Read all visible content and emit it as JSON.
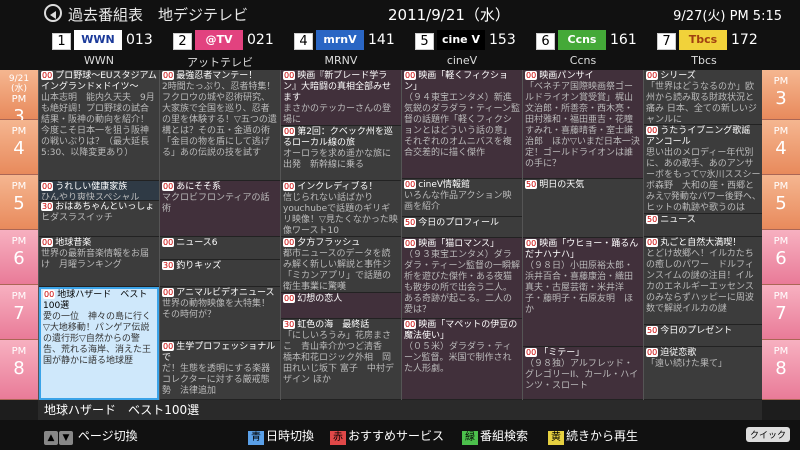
{
  "header": {
    "title": "過去番組表　地デジテレビ",
    "date": "2011/9/21（水）",
    "now": "9/27(火) PM 5:15"
  },
  "channels": [
    {
      "num": "1",
      "logo": "WWN",
      "logo_bg": "#ffffff",
      "logo_fg": "#1b3a9a",
      "cnum": "013",
      "name": "WWN"
    },
    {
      "num": "2",
      "logo": "@TV",
      "logo_bg": "#e2427f",
      "logo_fg": "#ffffff",
      "cnum": "021",
      "name": "アットテレビ"
    },
    {
      "num": "4",
      "logo": "mrnV",
      "logo_bg": "#2a66c4",
      "logo_fg": "#ffffff",
      "cnum": "141",
      "name": "MRNV"
    },
    {
      "num": "5",
      "logo": "cine V",
      "logo_bg": "#000000",
      "logo_fg": "#ffffff",
      "cnum": "153",
      "name": "cineV"
    },
    {
      "num": "6",
      "logo": "Ccns",
      "logo_bg": "#44a938",
      "logo_fg": "#ffffff",
      "cnum": "161",
      "name": "Ccns"
    },
    {
      "num": "7",
      "logo": "Tbcs",
      "logo_bg": "#f1d23a",
      "logo_fg": "#a04010",
      "cnum": "172",
      "name": "Tbcs"
    }
  ],
  "hours": [
    {
      "date": "9/21\n(水)",
      "pm": "PM",
      "h": "3"
    },
    {
      "pm": "PM",
      "h": "4"
    },
    {
      "pm": "PM",
      "h": "5"
    },
    {
      "pm": "PM",
      "h": "6"
    },
    {
      "pm": "PM",
      "h": "7"
    },
    {
      "pm": "PM",
      "h": "8"
    }
  ],
  "columns": [
    [
      {
        "min": "00",
        "title": "プロ野球～EUスタジアム　イングランド×ドイツ～",
        "desc": "山本志明　能内久天夫　9月も絶好調！プロ野球の試合結果・阪神の動向を紹介！今度こそ日本一を狙う阪神の戦いぶりは？（最大延長5:30、以降変更あり）",
        "style": "d",
        "h": 111
      },
      {
        "min": "00",
        "title": "うれしい健康家族",
        "desc": "ひんやり爽快スペシャル",
        "style": "n",
        "h": 20
      },
      {
        "min": "30",
        "title": "おはあちゃんといっしょ",
        "desc": "ヒダスラスイッチ",
        "style": "d",
        "h": 36
      },
      {
        "min": "00",
        "title": "地球昔楽",
        "desc": "世界の最新音楽情報をお届け　月曜ランキング",
        "style": "d",
        "h": 50
      },
      {
        "min": "00",
        "title": "地球ハザード　ベスト100選",
        "desc": "愛の一位　神々の島に行く　▽大地移動！パンゲア伝説の遺行形▽自然からの警告、荒れる海岸、消えた王国が静かに語る地球歴",
        "style": "sel",
        "h": 113
      }
    ],
    [
      {
        "min": "00",
        "title": "最強忍者マンテー！",
        "desc": "2時間たっぷり、忍者特集！フクロウの城や忍術研究、大家族で全国を巡り、忍者の里を体験する！▽五つの遺構とは？その五・金遁の術「金目の物を盾にして逃げる」あの伝説の技を試す",
        "style": "d",
        "h": 111
      },
      {
        "min": "00",
        "title": "あにそそ系",
        "desc": "マクロビフロンティアの話術",
        "style": "m",
        "h": 56
      },
      {
        "min": "00",
        "title": "ニュース6",
        "desc": "",
        "style": "d",
        "h": 23
      },
      {
        "min": "30",
        "title": "釣りキッズ",
        "desc": "",
        "style": "d",
        "h": 27
      },
      {
        "min": "00",
        "title": "アニマルビデオニュース",
        "desc": "世界の動物映像を大特集！その時何が？",
        "style": "d",
        "h": 54
      },
      {
        "min": "00",
        "title": "生学プロフェッショナルで",
        "desc": "だ！生態を透明にする楽器　コレクターに対する厳戒態勢　法律追加",
        "style": "d",
        "h": 59
      }
    ],
    [
      {
        "min": "00",
        "title": "映画『新ブレード学ラン』大暗闘の真相全部みせます",
        "desc": "まさかのテッカーさんの登場に",
        "style": "m",
        "h": 56
      },
      {
        "min": "00",
        "title": "第2回：クベック州を巡るローカル線の旅",
        "desc": "オーロラを求め遥かな旅に出発　新幹線に乗る",
        "style": "d",
        "h": 55
      },
      {
        "min": "00",
        "title": "インクレディブる！",
        "desc": "信じられない話ばかりyouchubeで話題のギリギリ映像！▽見たくなかった映像ワースト10",
        "style": "d",
        "h": 56
      },
      {
        "min": "00",
        "title": "夕方フラッシュ",
        "desc": "都市ニュースのデータを読み解く新しい解説と事件ジ「ミカンアプリ」で話題の衛生事業に驚嘆",
        "style": "d",
        "h": 56
      },
      {
        "min": "00",
        "title": "幻想の恋人",
        "desc": "",
        "style": "m",
        "h": 26
      },
      {
        "min": "30",
        "title": "虹色の海　最終話",
        "desc": "「にしいろうみ」花房まさこ　青山幸介かつど清香　橋本和花ロジック外相　岡田れいじ坂下 富子　中村デザイン ほか",
        "style": "d",
        "h": 81
      }
    ],
    [
      {
        "min": "00",
        "title": "映画「軽くフィクション」",
        "desc": "（９４東宝エンタメ）新進気鋭のダラダラ・ティーン監督の話題作「軽くフィクションとはどういう話の意」それぞれのオムニバスを複合交差的に描く傑作",
        "style": "m",
        "h": 109
      },
      {
        "min": "00",
        "title": "cineV情報館",
        "desc": "いろんな作品アクション映画を紹介",
        "style": "d",
        "h": 38
      },
      {
        "min": "50",
        "title": "今日のプロフィール",
        "desc": "",
        "style": "d",
        "h": 21
      },
      {
        "min": "00",
        "title": "映画「猫ロマンス」",
        "desc": "（９３東宝エンタメ）ダラダラ・ティーン監督の一瞬解析を遊びた傑作・ある夜猫も散歩の所で出会う二人。ある奇跡が起こる。二人の愛は？",
        "style": "m",
        "h": 81
      },
      {
        "min": "00",
        "title": "映画「マペットの伊豆の魔法使い」",
        "desc": "（０５米）ダラダラ・ティーン監督。米国で制作された人形劇。",
        "style": "m",
        "h": 81
      }
    ],
    [
      {
        "min": "00",
        "title": "映画パンサイ",
        "desc": "「ベネチア国際映画祭ゴールドライオン賞受賞」梶山文治郎・所善奈・西木亮・田村雅和・福田亜吉・花瞳すみれ・喜藤晴香・室士謙治郎　ほか▽いまだ日本一決定！ゴールドライオンは誰の手に？",
        "style": "m",
        "h": 109
      },
      {
        "min": "50",
        "title": "明日の天気",
        "desc": "",
        "style": "d",
        "h": 59
      },
      {
        "min": "00",
        "title": "映画「ウヒョー・踊るんだナハナハ」",
        "desc": "（９８日）小田原裕太郎・浜井百合・喜藤康治・織田真夫・古屋芸衛・米井洋子・藤明子・石原友明　ほか",
        "style": "m",
        "h": 109
      },
      {
        "min": "00",
        "title": "「ミテー」",
        "desc": "（９８独）アルフレッド・グレゴリーII、カール・ハインツ・スロート",
        "style": "m",
        "h": 53
      }
    ],
    [
      {
        "min": "00",
        "title": "シリーズ",
        "desc": "「世界はどうなるのか」欧州から読み取る財政状況と痛み 日本、全ての新しいジャンルに",
        "style": "d",
        "h": 55
      },
      {
        "min": "00",
        "title": "うたうイブニング歌謡　アンコール",
        "desc": "思い出のメロディー年代別に、あの歌手、あのアンサーボをもって▽氷川ススシーボ森野　大和の座・西郷とみえ▽発動なパワー後野ヘ、ヒットの軌跡や歌うのは",
        "style": "d",
        "h": 89
      },
      {
        "min": "50",
        "title": "ニュース",
        "desc": "",
        "style": "d",
        "h": 23
      },
      {
        "min": "00",
        "title": "丸ごと自然大満喫！",
        "desc": "とどけ故郷へ！イルカたちの癒しのパワー　ドルフィンスイムの謎の注目！イルカのエネルギーエッセンスのみならずハッピーに周波数で解説イルカの謎",
        "style": "d",
        "h": 88
      },
      {
        "min": "50",
        "title": "今日のプレゼント",
        "desc": "",
        "style": "d",
        "h": 22
      },
      {
        "min": "00",
        "title": "迫従恋歌",
        "desc": "「遠い続けた果て」",
        "style": "d",
        "h": 53
      }
    ]
  ],
  "selected_title": "地球ハザード　ベスト100選",
  "footer": {
    "page": "ページ切換",
    "blue_key": "青",
    "blue": "日時切換",
    "red_key": "赤",
    "red": "おすすめサービス",
    "green_key": "緑",
    "green": "番組検索",
    "yellow_key": "黄",
    "yellow": "続きから再生",
    "quick": "クイック"
  }
}
